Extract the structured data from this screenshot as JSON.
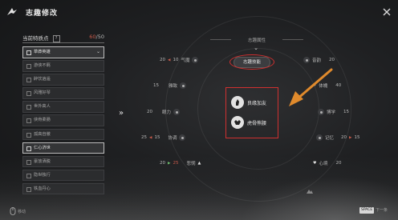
{
  "header": {
    "title": "志趣修改"
  },
  "traits_panel": {
    "title": "当前特质点",
    "help": "?",
    "current": "60",
    "max": "/50",
    "items": [
      {
        "label": "草莽英雄",
        "selected": true,
        "dropdown": "⌄"
      },
      {
        "label": "游侠不羁",
        "selected": false
      },
      {
        "label": "醉饮逍遥",
        "selected": false
      },
      {
        "label": "风雅好琴",
        "selected": false
      },
      {
        "label": "世外高人",
        "selected": false
      },
      {
        "label": "侠骨柔肠",
        "selected": false
      },
      {
        "label": "孤高自傲",
        "selected": false
      },
      {
        "label": "仁心济世",
        "selected": true
      },
      {
        "label": "豪放洒脱",
        "selected": false
      },
      {
        "label": "隐世独行",
        "selected": false
      },
      {
        "label": "铁血丹心",
        "selected": false
      }
    ]
  },
  "center": {
    "section_label": "志趣属性",
    "chevron": "⌄",
    "chip_label": "志趣技能",
    "expand_arrow": "»",
    "skills": [
      {
        "label": "良缘加友"
      },
      {
        "label": "虎骨熊腰"
      }
    ]
  },
  "attributes": {
    "qi": {
      "base": "20",
      "delta": "10",
      "label": "气魔"
    },
    "meili": {
      "base": "15",
      "label": "雅致"
    },
    "yanli": {
      "base": "20",
      "label": "眼力"
    },
    "xietiao": {
      "base": "25",
      "delta": "15",
      "label": "协调"
    },
    "beishi": {
      "base": "20",
      "delta": "25",
      "label": "悲悯"
    },
    "yinlv": {
      "base": "20",
      "label": "音韵"
    },
    "tipo": {
      "label": "体魄",
      "base": "40"
    },
    "boxue": {
      "label": "博学",
      "base": "15"
    },
    "jiyi": {
      "label": "记忆",
      "base": "20",
      "delta": "15"
    },
    "xinjing": {
      "label": "心境",
      "base": "20"
    }
  },
  "footer": {
    "left_hint": "移动",
    "space_key": "SPACE",
    "space_hint": "下一条"
  },
  "colors": {
    "accent_red": "#d03030",
    "accent_orange": "#e08a2c",
    "decrease": "#c85a4a",
    "increase": "#6fc06f"
  }
}
